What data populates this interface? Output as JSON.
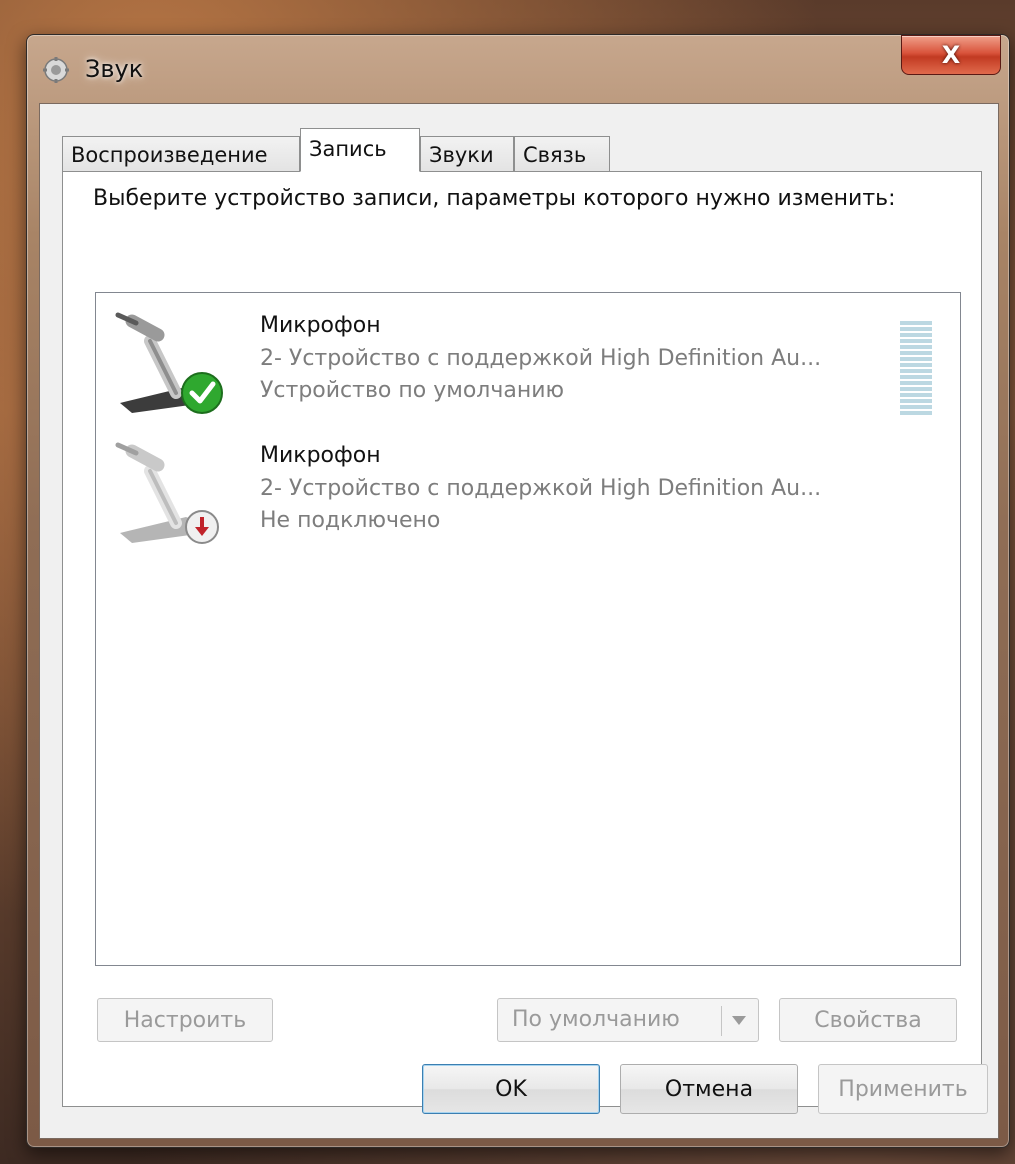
{
  "window": {
    "title": "Звук",
    "close_label": "X"
  },
  "tabs": [
    {
      "label": "Воспроизведение",
      "active": false
    },
    {
      "label": "Запись",
      "active": true
    },
    {
      "label": "Звуки",
      "active": false
    },
    {
      "label": "Связь",
      "active": false
    }
  ],
  "panel": {
    "instruction": "Выберите устройство записи, параметры которого нужно изменить:",
    "devices": [
      {
        "name": "Микрофон",
        "description": "2- Устройство с поддержкой High Definition Au...",
        "status": "Устройство по умолчанию",
        "icon": "microphone-default-icon"
      },
      {
        "name": "Микрофон",
        "description": "2- Устройство с поддержкой High Definition Au...",
        "status": "Не подключено",
        "icon": "microphone-disconnected-icon"
      }
    ],
    "buttons": {
      "configure": "Настроить",
      "set_default": "По умолчанию",
      "properties": "Свойства"
    }
  },
  "footer": {
    "ok": "OK",
    "cancel": "Отмена",
    "apply": "Применить"
  },
  "colors": {
    "accent_check": "#2fa82f",
    "disconnected_badge": "#c0232a",
    "level_meter": "#bcd8e2"
  }
}
